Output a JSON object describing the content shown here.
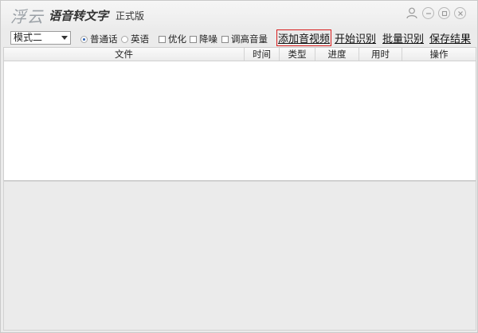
{
  "titlebar": {
    "brand": "浮云",
    "app_title": "语音转文字",
    "edition": "正式版",
    "controls": [
      "user-icon",
      "minimize-icon",
      "restore-icon",
      "close-icon"
    ]
  },
  "toolbar": {
    "mode_value": "模式二",
    "lang_options": [
      {
        "label": "普通话",
        "checked": true
      },
      {
        "label": "英语",
        "checked": false
      }
    ],
    "checks": [
      {
        "label": "优化",
        "checked": false
      },
      {
        "label": "降噪",
        "checked": false
      },
      {
        "label": "调高音量",
        "checked": false
      }
    ],
    "actions": [
      {
        "label": "添加音视频",
        "highlighted": true
      },
      {
        "label": "开始识别",
        "highlighted": false
      },
      {
        "label": "批量识别",
        "highlighted": false
      },
      {
        "label": "保存结果",
        "highlighted": false
      }
    ]
  },
  "table": {
    "columns": [
      "文件",
      "时间",
      "类型",
      "进度",
      "用时",
      "操作"
    ],
    "rows": []
  },
  "colors": {
    "highlight_border": "#d81e1e",
    "radio_accent": "#2a5fb3"
  }
}
